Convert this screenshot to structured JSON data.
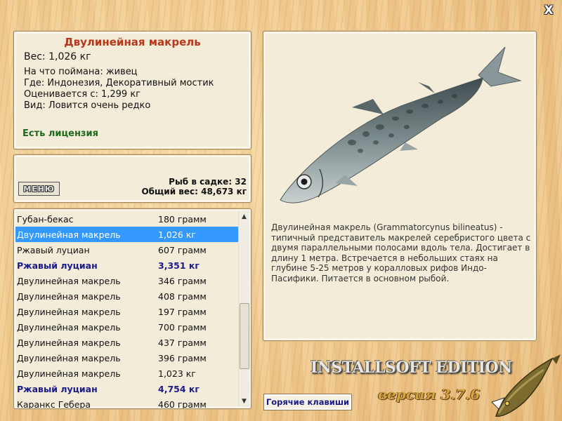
{
  "window": {
    "close_label": "X"
  },
  "info": {
    "title": "Двулинейная макрель",
    "weight": "Вес: 1,026 кг",
    "caught_with": "На что поймана: живец",
    "where": "Где: Индонезия, Декоративный мостик",
    "valued_from": "Оценивается с: 1,299 кг",
    "kind": "Вид: Ловится очень редко",
    "license": "Есть лицензия"
  },
  "summary": {
    "menu_label": "МЕНЮ",
    "fish_count": "Рыб в садке: 32",
    "total_weight": "Общий вес: 48,673 кг"
  },
  "fish_list": [
    {
      "name": "Губан-бекас",
      "weight": "180 грамм",
      "state": "normal"
    },
    {
      "name": "Двулинейная макрель",
      "weight": "1,026 кг",
      "state": "selected"
    },
    {
      "name": "Ржавый луциан",
      "weight": "607 грамм",
      "state": "normal"
    },
    {
      "name": "Ржавый луциан",
      "weight": "3,351 кг",
      "state": "bold"
    },
    {
      "name": "Двулинейная макрель",
      "weight": "346 грамм",
      "state": "normal"
    },
    {
      "name": "Двулинейная макрель",
      "weight": "408 грамм",
      "state": "normal"
    },
    {
      "name": "Двулинейная макрель",
      "weight": "197 грамм",
      "state": "normal"
    },
    {
      "name": "Двулинейная макрель",
      "weight": "700 грамм",
      "state": "normal"
    },
    {
      "name": "Двулинейная макрель",
      "weight": "437 грамм",
      "state": "normal"
    },
    {
      "name": "Двулинейная макрель",
      "weight": "396 грамм",
      "state": "normal"
    },
    {
      "name": "Двулинейная макрель",
      "weight": "1,023 кг",
      "state": "normal"
    },
    {
      "name": "Ржавый луциан",
      "weight": "4,754 кг",
      "state": "bold"
    },
    {
      "name": "Каранкс Гебера",
      "weight": "460 грамм",
      "state": "normal"
    }
  ],
  "detail": {
    "image_icon": "mackerel-fish-image",
    "description": "Двулинейная макрель (Grammatorcynus bilineatus) - типичный представитель макрелей серебристого цвета с двумя параллельными полосами вдоль тела. Достигает в длину 1 метра. Встречается в небольших стаях на глубине 5-25 метров у коралловых рифов Индо-Пасифики. Питается в основном рыбой."
  },
  "footer": {
    "hotkeys_label": "Горячие клавиши",
    "brand": "INSTALLSOFT EDITION",
    "version": "версия 3.7.6",
    "logo_icon": "pike-logo"
  }
}
